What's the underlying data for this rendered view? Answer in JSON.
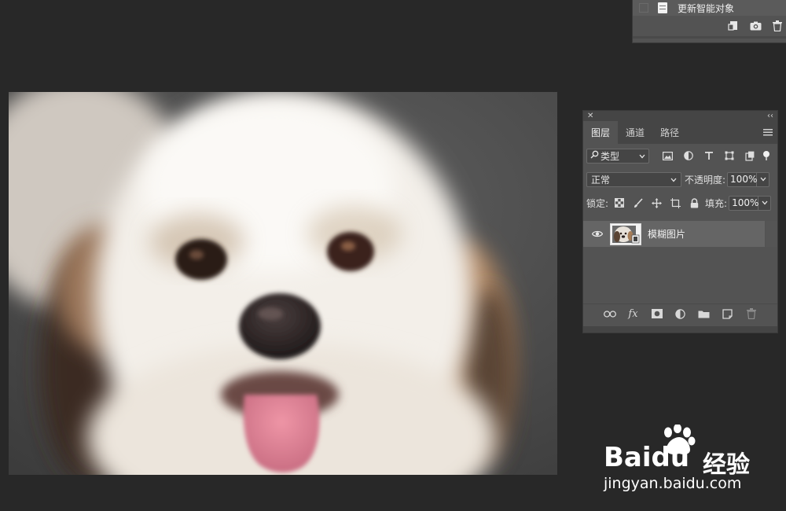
{
  "history_panel": {
    "row_label": "更新智能对象"
  },
  "layers_panel": {
    "close_symbol": "✕",
    "collapse_symbol": "‹‹",
    "tabs": [
      {
        "label": "图层",
        "active": true
      },
      {
        "label": "通道",
        "active": false
      },
      {
        "label": "路径",
        "active": false
      }
    ],
    "filter": {
      "kind_label": "类型"
    },
    "blend_mode": "正常",
    "opacity_label": "不透明度:",
    "opacity_value": "100%",
    "lock_label": "锁定:",
    "fill_label": "填充:",
    "fill_value": "100%",
    "layers": [
      {
        "name": "模糊图片",
        "visible": true,
        "selected": true
      }
    ],
    "fx_label": "fx"
  },
  "watermark": {
    "brand": "Bai",
    "brand_tail": "du",
    "jingyan": "经验",
    "url": "jingyan.baidu.com"
  },
  "colors": {
    "app_background": "#282828",
    "panel_background": "#535353",
    "selected_layer": "#656565"
  }
}
